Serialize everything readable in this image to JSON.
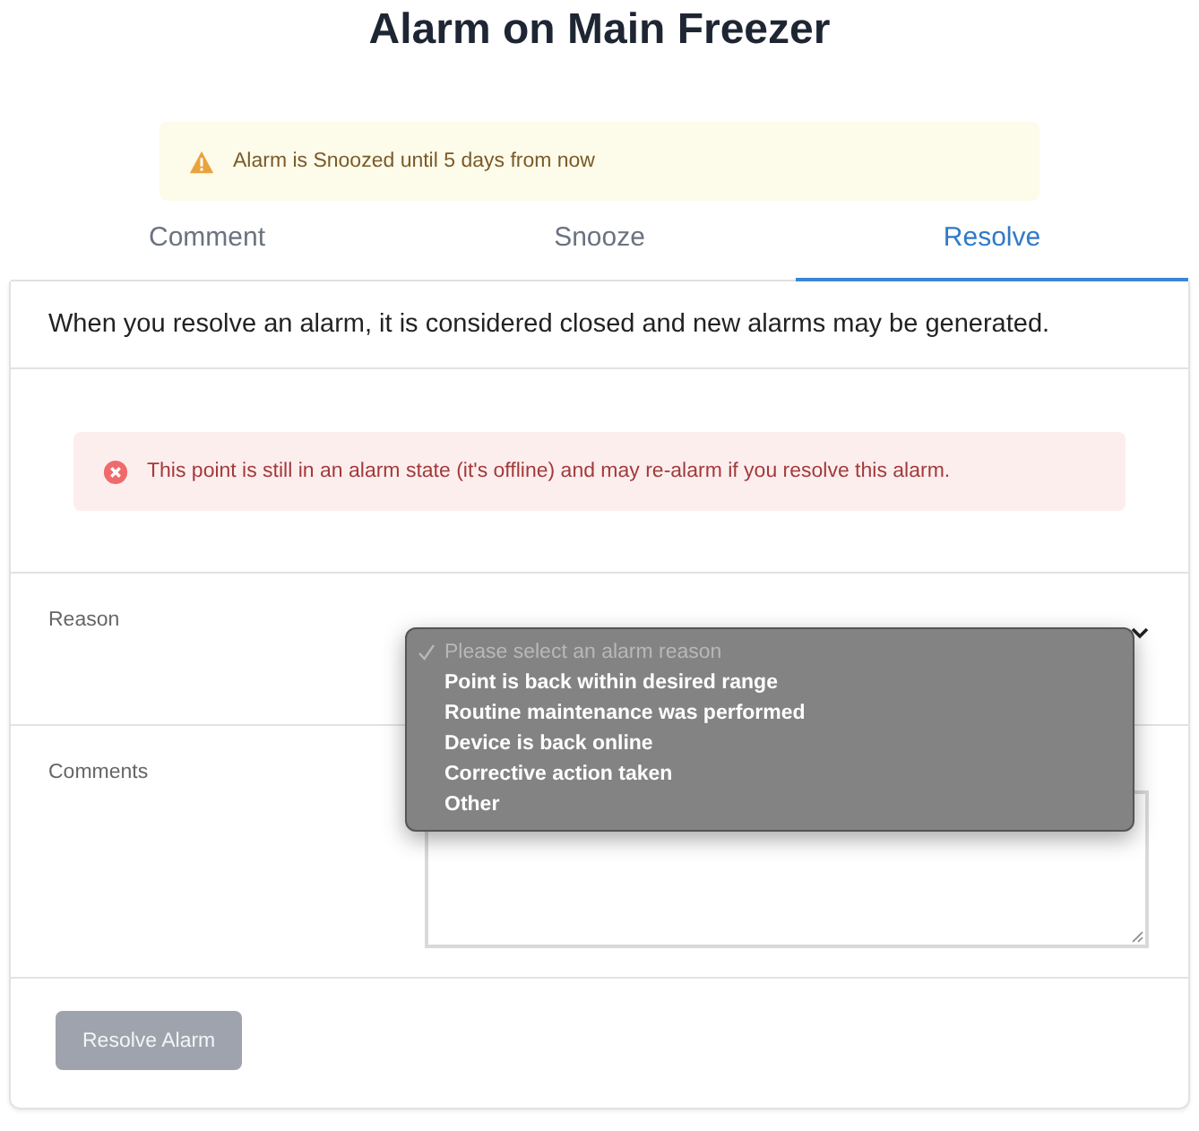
{
  "title": "Alarm on Main Freezer",
  "snooze_notice": {
    "kind": "warning",
    "text": "Alarm is Snoozed until 5 days from now"
  },
  "tabs": [
    {
      "label": "Comment",
      "selected": false
    },
    {
      "label": "Snooze",
      "selected": false
    },
    {
      "label": "Resolve",
      "selected": true
    }
  ],
  "description": "When you resolve an alarm, it is considered closed and new alarms may be generated.",
  "error_notice": {
    "kind": "error",
    "text": "This point is still in an alarm state (it's offline) and may re-alarm if you resolve this alarm."
  },
  "reason": {
    "label": "Reason",
    "expanded": true,
    "options": [
      {
        "label": "Please select an alarm reason",
        "selected": true,
        "disabled": true
      },
      {
        "label": "Point is back within desired range",
        "selected": false,
        "disabled": false
      },
      {
        "label": "Routine maintenance was performed",
        "selected": false,
        "disabled": false
      },
      {
        "label": "Device is back online",
        "selected": false,
        "disabled": false
      },
      {
        "label": "Corrective action taken",
        "selected": false,
        "disabled": false
      },
      {
        "label": "Other",
        "selected": false,
        "disabled": false
      }
    ]
  },
  "comments": {
    "label": "Comments"
  },
  "submit": {
    "label": "Resolve Alarm",
    "disabled": true
  }
}
